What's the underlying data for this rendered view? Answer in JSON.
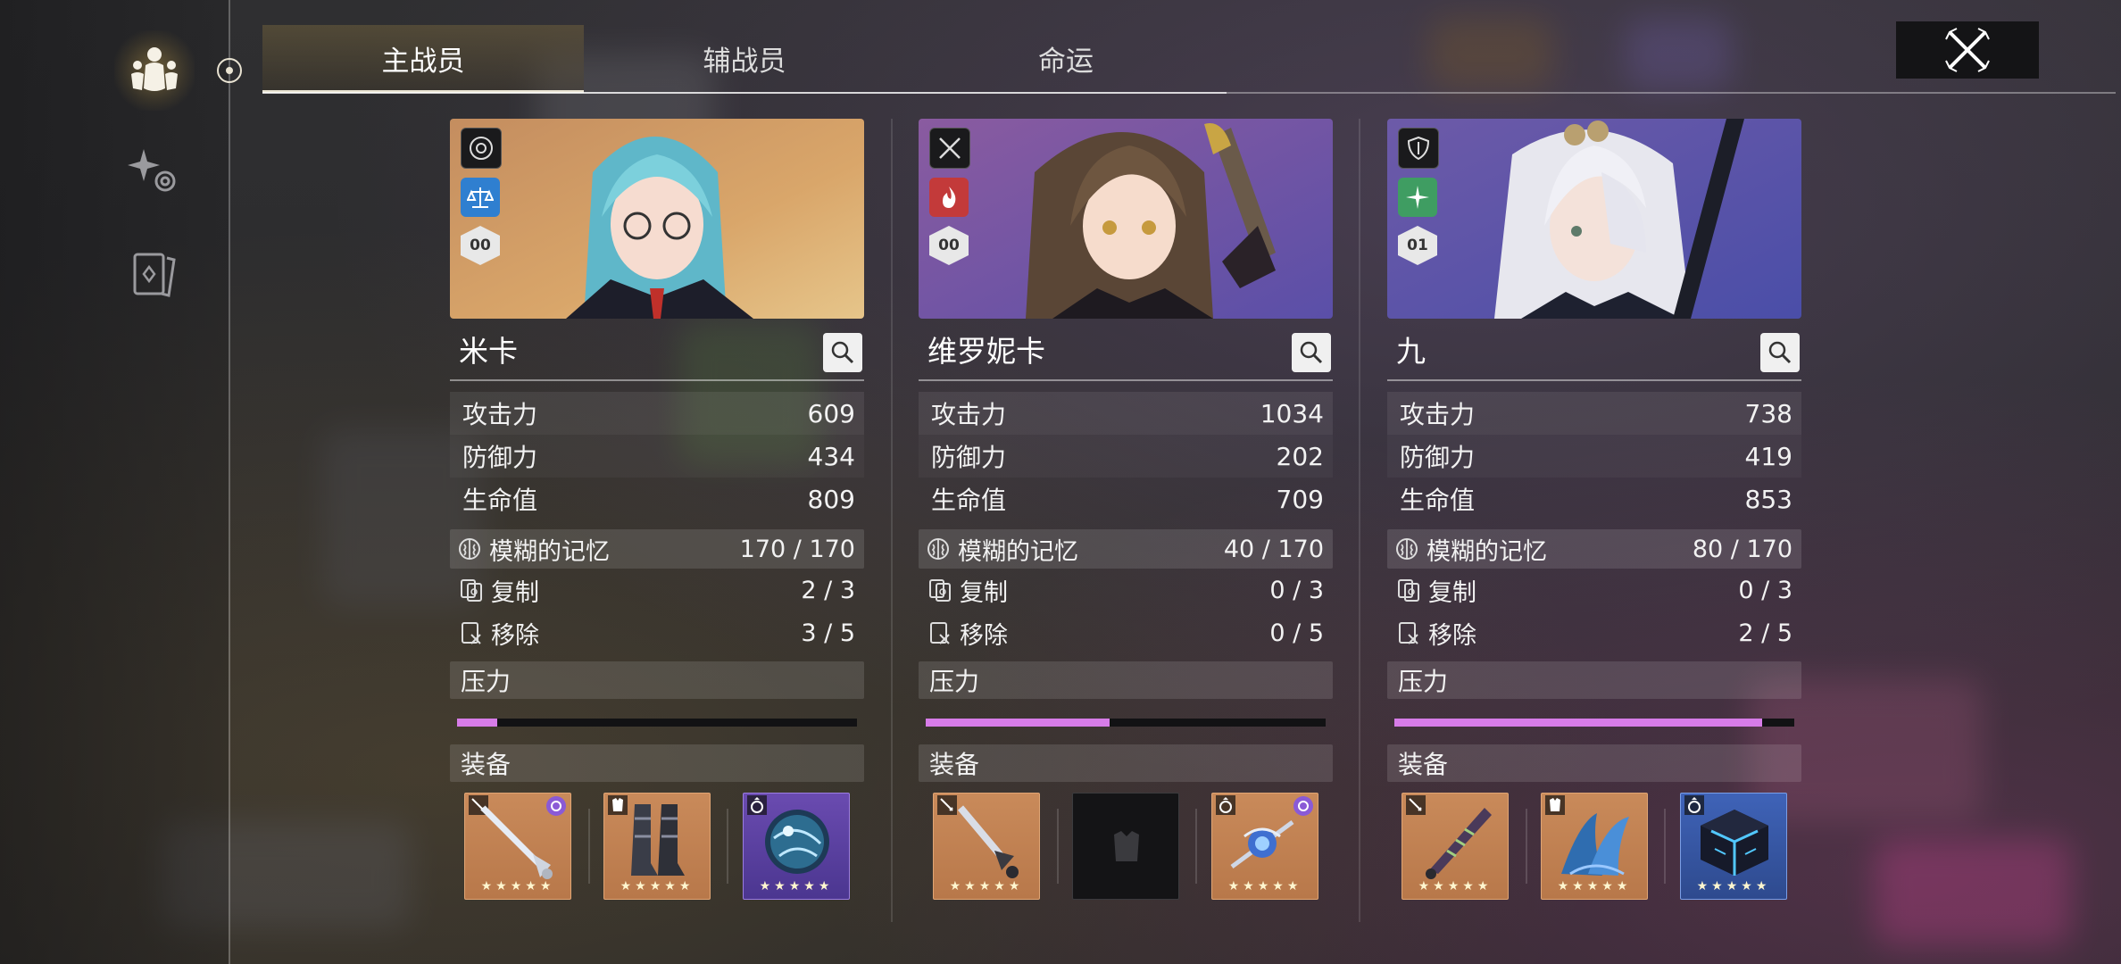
{
  "tabs": [
    "主战员",
    "辅战员",
    "命运"
  ],
  "colors": {
    "accent": "#d77ce8",
    "tab_active": "#8c7a4c"
  },
  "characters": [
    {
      "name": "米卡",
      "level_badge": "00",
      "class_icon": "target-icon",
      "element_icon": "scales-icon",
      "stats": [
        {
          "label": "攻击力",
          "value": "609"
        },
        {
          "label": "防御力",
          "value": "434"
        },
        {
          "label": "生命值",
          "value": "809"
        }
      ],
      "memory": {
        "label": "模糊的记忆",
        "value": "170 / 170"
      },
      "copy": {
        "label": "复制",
        "value": "2 / 3"
      },
      "remove": {
        "label": "移除",
        "value": "3 / 5"
      },
      "stress_label": "压力",
      "stress": 0.1,
      "equip_label": "装备",
      "equipment": [
        {
          "type": "weapon",
          "rarity": "orange",
          "item": "sword-icon",
          "stars": "★★★★★"
        },
        {
          "type": "armor",
          "rarity": "orange",
          "item": "boots-icon",
          "stars": "★★★★★"
        },
        {
          "type": "accessory",
          "rarity": "purple",
          "item": "orb-icon",
          "stars": "★★★★★"
        }
      ]
    },
    {
      "name": "维罗妮卡",
      "level_badge": "00",
      "class_icon": "crossed-swords-icon",
      "element_icon": "flame-icon",
      "stats": [
        {
          "label": "攻击力",
          "value": "1034"
        },
        {
          "label": "防御力",
          "value": "202"
        },
        {
          "label": "生命值",
          "value": "709"
        }
      ],
      "memory": {
        "label": "模糊的记忆",
        "value": "40 / 170"
      },
      "copy": {
        "label": "复制",
        "value": "0 / 3"
      },
      "remove": {
        "label": "移除",
        "value": "0 / 5"
      },
      "stress_label": "压力",
      "stress": 0.46,
      "equip_label": "装备",
      "equipment": [
        {
          "type": "weapon",
          "rarity": "orange",
          "item": "dagger-icon",
          "stars": "★★★★★"
        },
        {
          "type": "armor",
          "rarity": "empty",
          "item": "armor-placeholder-icon",
          "stars": ""
        },
        {
          "type": "accessory",
          "rarity": "orange",
          "item": "staff-orb-icon",
          "stars": "★★★★★"
        }
      ]
    },
    {
      "name": "九",
      "level_badge": "01",
      "class_icon": "shield-icon",
      "element_icon": "star-burst-icon",
      "stats": [
        {
          "label": "攻击力",
          "value": "738"
        },
        {
          "label": "防御力",
          "value": "419"
        },
        {
          "label": "生命值",
          "value": "853"
        }
      ],
      "memory": {
        "label": "模糊的记忆",
        "value": "80 / 170"
      },
      "copy": {
        "label": "复制",
        "value": "0 / 3"
      },
      "remove": {
        "label": "移除",
        "value": "2 / 5"
      },
      "stress_label": "压力",
      "stress": 0.92,
      "equip_label": "装备",
      "equipment": [
        {
          "type": "weapon",
          "rarity": "orange",
          "item": "jagged-blade-icon",
          "stars": "★★★★★"
        },
        {
          "type": "armor",
          "rarity": "orange",
          "item": "feather-claw-icon",
          "stars": "★★★★★"
        },
        {
          "type": "accessory",
          "rarity": "blue",
          "item": "cube-icon",
          "stars": "★★★★★"
        }
      ]
    }
  ]
}
